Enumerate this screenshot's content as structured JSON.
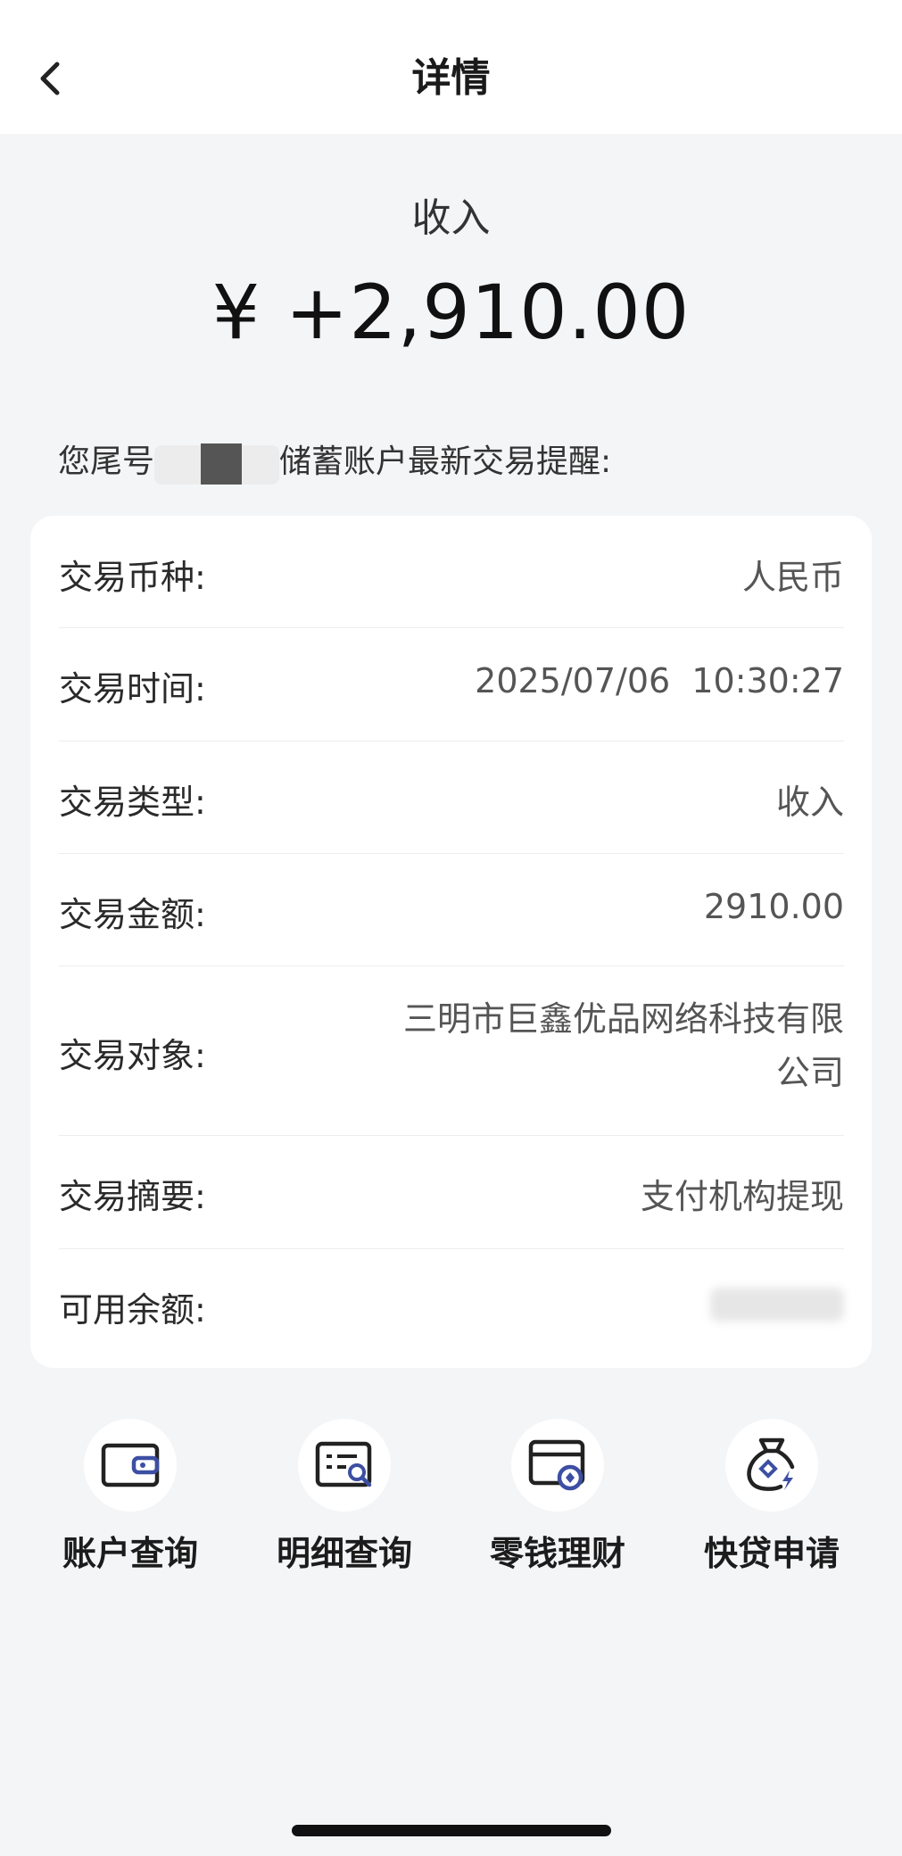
{
  "header": {
    "title": "详情"
  },
  "summary": {
    "type": "收入",
    "amount": "¥ +2,910.00"
  },
  "notice": {
    "prefix": "您尾号",
    "suffix": "储蓄账户最新交易提醒:"
  },
  "details": [
    {
      "label": "交易币种:",
      "value": "人民币"
    },
    {
      "label": "交易时间:",
      "value": "2025/07/06  10:30:27"
    },
    {
      "label": "交易类型:",
      "value": "收入"
    },
    {
      "label": "交易金额:",
      "value": "2910.00"
    },
    {
      "label": "交易对象:",
      "value": "三明市巨鑫优品网络科技有限公司"
    },
    {
      "label": "交易摘要:",
      "value": "支付机构提现"
    },
    {
      "label": "可用余额:",
      "value": ""
    }
  ],
  "actions": [
    {
      "label": "账户查询",
      "icon": "wallet-icon"
    },
    {
      "label": "明细查询",
      "icon": "statement-search-icon"
    },
    {
      "label": "零钱理财",
      "icon": "card-coin-icon"
    },
    {
      "label": "快贷申请",
      "icon": "money-bag-bolt-icon"
    }
  ],
  "colors": {
    "accent": "#3d4fa3",
    "background": "#f4f5f7",
    "card": "#ffffff"
  }
}
